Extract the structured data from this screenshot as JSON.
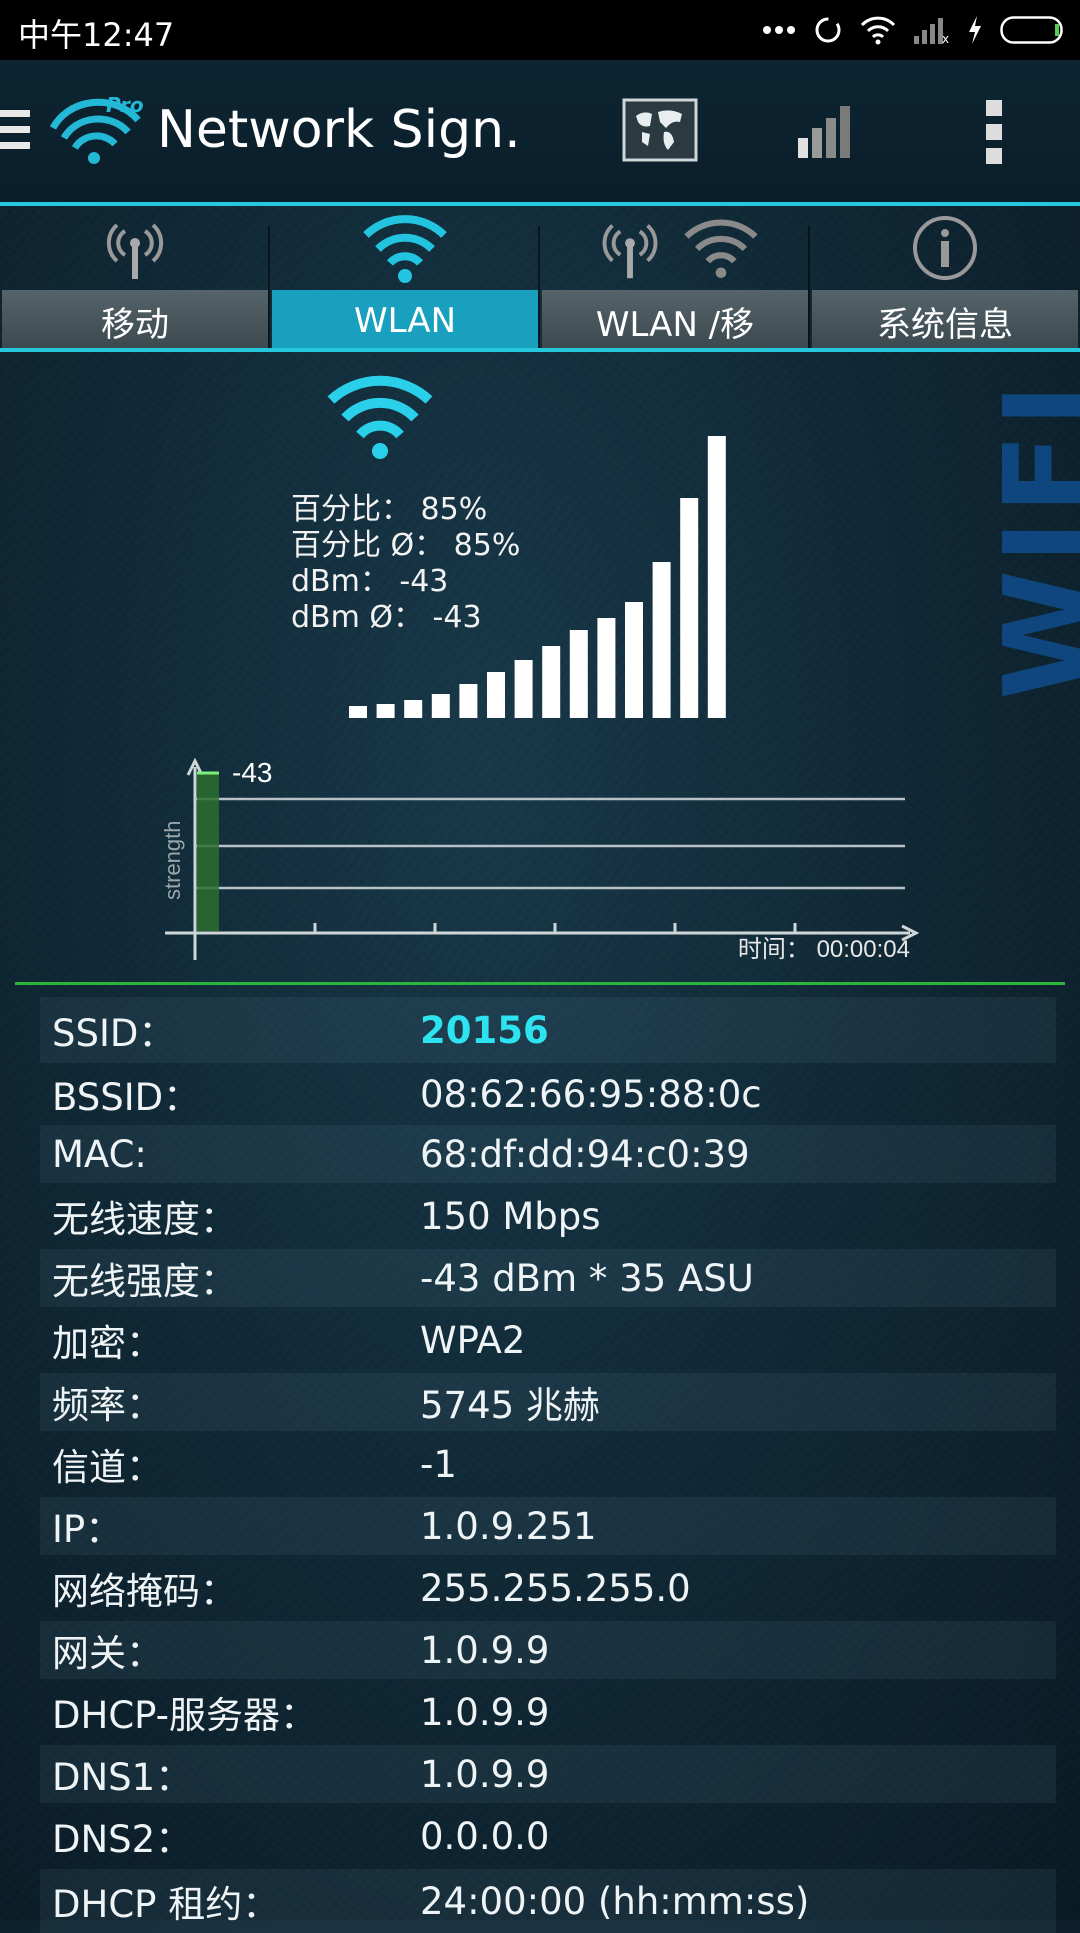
{
  "status_bar": {
    "time": "中午12:47"
  },
  "app": {
    "title": "Network Sign.",
    "logo_badge": "Pro"
  },
  "tabs": [
    {
      "label": "移动",
      "icon": "cell-tower-icon"
    },
    {
      "label": "WLAN",
      "icon": "wifi-icon",
      "active": true
    },
    {
      "label": "WLAN /移",
      "icon": "tower-and-wifi-icon"
    },
    {
      "label": "系统信息",
      "icon": "info-icon"
    }
  ],
  "meter": {
    "percent_label": "百分比：  85%",
    "percent_avg_label": "百分比 Ø：  85%",
    "dbm_label": "dBm：  -43",
    "dbm_avg_label": "dBm Ø：  -43",
    "signal_percent": 85,
    "bars_total": 14,
    "bars_lit": 14,
    "watermark": "WIFI"
  },
  "graph": {
    "current_value": "-43",
    "y_label": "strength",
    "time_label": "时间：  00:00:04"
  },
  "info": [
    {
      "key": "SSID：",
      "value": "20156",
      "highlight": true
    },
    {
      "key": "BSSID：",
      "value": "08:62:66:95:88:0c"
    },
    {
      "key": "MAC:",
      "value": "68:df:dd:94:c0:39"
    },
    {
      "key": "无线速度：",
      "value": "150 Mbps"
    },
    {
      "key": "无线强度：",
      "value": "-43 dBm * 35 ASU"
    },
    {
      "key": "加密：",
      "value": "WPA2"
    },
    {
      "key": "频率：",
      "value": "5745 兆赫"
    },
    {
      "key": "信道：",
      "value": "-1"
    },
    {
      "key": "IP：",
      "value": "1.0.9.251"
    },
    {
      "key": "网络掩码：",
      "value": "255.255.255.0"
    },
    {
      "key": "网关：",
      "value": "1.0.9.9"
    },
    {
      "key": "DHCP-服务器：",
      "value": "1.0.9.9"
    },
    {
      "key": "DNS1：",
      "value": "1.0.9.9"
    },
    {
      "key": "DNS2：",
      "value": "0.0.0.0"
    },
    {
      "key": "DHCP 租约：",
      "value": "24:00:00 (hh:mm:ss)"
    }
  ],
  "colors": {
    "accent": "#26c8dd",
    "active_tab": "#1aa0bf",
    "ssid": "#2ee3f0",
    "divider": "#2bb53a"
  }
}
